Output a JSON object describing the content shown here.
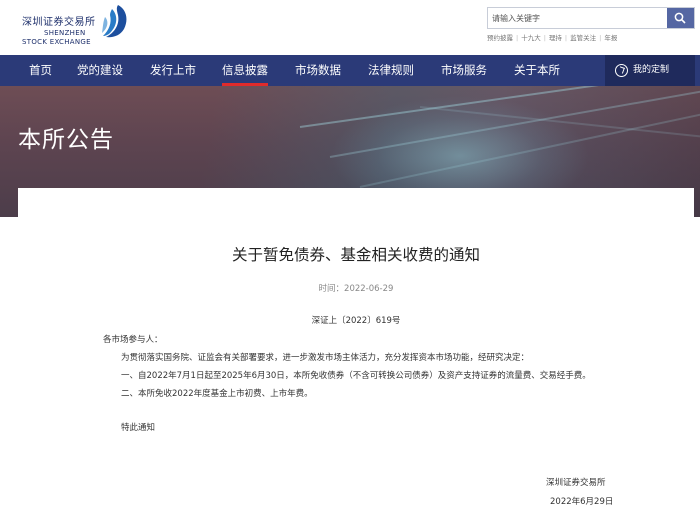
{
  "header": {
    "logo_cn": "深圳证券交易所",
    "logo_en_line1": "SHENZHEN",
    "logo_en_line2": "STOCK EXCHANGE",
    "search_placeholder": "请输入关键字",
    "quick_links": [
      "预约披露",
      "十九大",
      "理持",
      "监管关注",
      "年报"
    ]
  },
  "nav": {
    "items": [
      "首页",
      "党的建设",
      "发行上市",
      "信息披露",
      "市场数据",
      "法律规则",
      "市场服务",
      "关于本所"
    ],
    "active": "信息披露",
    "custom_label": "我的定制"
  },
  "banner": {
    "title": "本所公告"
  },
  "article": {
    "title": "关于暂免债券、基金相关收费的通知",
    "time": "时间：2022-06-29",
    "doc_number": "深证上〔2022〕619号",
    "salutation": "各市场参与人：",
    "paragraphs": [
      "为贯彻落实国务院、证监会有关部署要求，进一步激发市场主体活力，充分发挥资本市场功能，经研究决定：",
      "一、自2022年7月1日起至2025年6月30日，本所免收债券（不含可转换公司债券）及资产支持证券的流量费、交易经手费。",
      "二、本所免收2022年度基金上市初费、上市年费。"
    ],
    "closing": "特此通知",
    "sign_org": "深圳证券交易所",
    "sign_date": "2022年6月29日"
  },
  "colors": {
    "nav_bg": "#2b3a78",
    "active_underline": "#e02b2b",
    "search_button": "#5567a3"
  }
}
